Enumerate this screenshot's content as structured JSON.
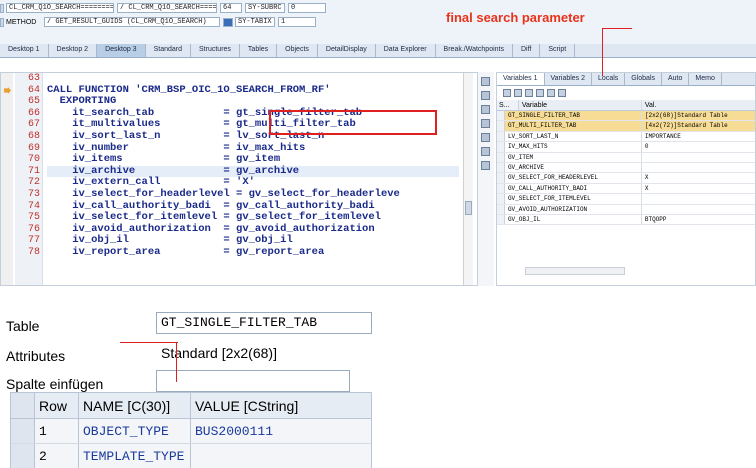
{
  "status_row1": {
    "field1": "CL_CRM_Q1O_SEARCH=============",
    "field2": "/ CL_CRM_Q1O_SEARCH=============",
    "field3": "64",
    "field4": "SY-SUBRC",
    "field5": "0"
  },
  "status_row2": {
    "label": "METHOD",
    "field1": "/ GET_RESULT_GUIDS (CL_CRM_Q1O_SEARCH)",
    "field2": "SY-TABIX",
    "field3": "1"
  },
  "heading": "final search parameter",
  "desktop_tabs": [
    "Desktop 1",
    "Desktop 2",
    "Desktop 3",
    "Standard",
    "Structures",
    "Tables",
    "Objects",
    "DetailDisplay",
    "Data Explorer",
    "Break./Watchpoints",
    "Diff",
    "Script"
  ],
  "code": {
    "line_numbers": [
      "63",
      "64",
      "65",
      "66",
      "67",
      "68",
      "69",
      "70",
      "71",
      "72",
      "73",
      "74",
      "75",
      "76",
      "77",
      "78"
    ],
    "lines": [
      "",
      "CALL FUNCTION 'CRM_BSP_OIC_1O_SEARCH_FROM_RF'",
      "  EXPORTING",
      "    it_search_tab           = gt_single_filter_tab",
      "    it_multivalues          = gt_multi_filter_tab",
      "    iv_sort_last_n          = lv_sort_last_n",
      "    iv_number               = iv_max_hits",
      "    iv_items                = gv_item",
      "    iv_archive              = gv_archive",
      "    iv_extern_call          = 'X'",
      "    iv_select_for_headerlevel = gv_select_for_headerleve",
      "    iv_call_authority_badi  = gv_call_authority_badi",
      "    iv_select_for_itemlevel = gv_select_for_itemlevel",
      "    iv_avoid_authorization  = gv_avoid_authorization",
      "    iv_obj_il               = gv_obj_il",
      "    iv_report_area          = gv_report_area"
    ]
  },
  "variables": {
    "tabs": [
      "Variables 1",
      "Variables 2",
      "Locals",
      "Globals",
      "Auto",
      "Memo"
    ],
    "columns": [
      "S...",
      "Variable",
      "Val."
    ],
    "rows": [
      {
        "name": "GT_SINGLE_FILTER_TAB",
        "value": "[2x2(68)]Standard Table"
      },
      {
        "name": "GT_MULTI_FILTER_TAB",
        "value": "[4x2(72)]Standard Table"
      },
      {
        "name": "LV_SORT_LAST_N",
        "value": "IMPORTANCE"
      },
      {
        "name": "IV_MAX_HITS",
        "value": "0"
      },
      {
        "name": "GV_ITEM",
        "value": ""
      },
      {
        "name": "GV_ARCHIVE",
        "value": ""
      },
      {
        "name": "GV_SELECT_FOR_HEADERLEVEL",
        "value": "X"
      },
      {
        "name": "GV_CALL_AUTHORITY_BADI",
        "value": "X"
      },
      {
        "name": "GV_SELECT_FOR_ITEMLEVEL",
        "value": ""
      },
      {
        "name": "GV_AVOID_AUTHORIZATION",
        "value": ""
      },
      {
        "name": "GV_OBJ_IL",
        "value": "BTQOPP"
      }
    ]
  },
  "detail": {
    "table_label": "Table",
    "table_value": "GT_SINGLE_FILTER_TAB",
    "attributes_label": "Attributes",
    "attributes_value": "Standard [2x2(68)]",
    "insert_label": "Spalte einfügen",
    "insert_value": "",
    "columns": [
      "Row",
      "NAME [C(30)]",
      "VALUE [CString]"
    ],
    "rows": [
      {
        "row": "1",
        "name": "OBJECT_TYPE",
        "value": "BUS2000111"
      },
      {
        "row": "2",
        "name": "TEMPLATE_TYPE",
        "value": ""
      }
    ]
  }
}
